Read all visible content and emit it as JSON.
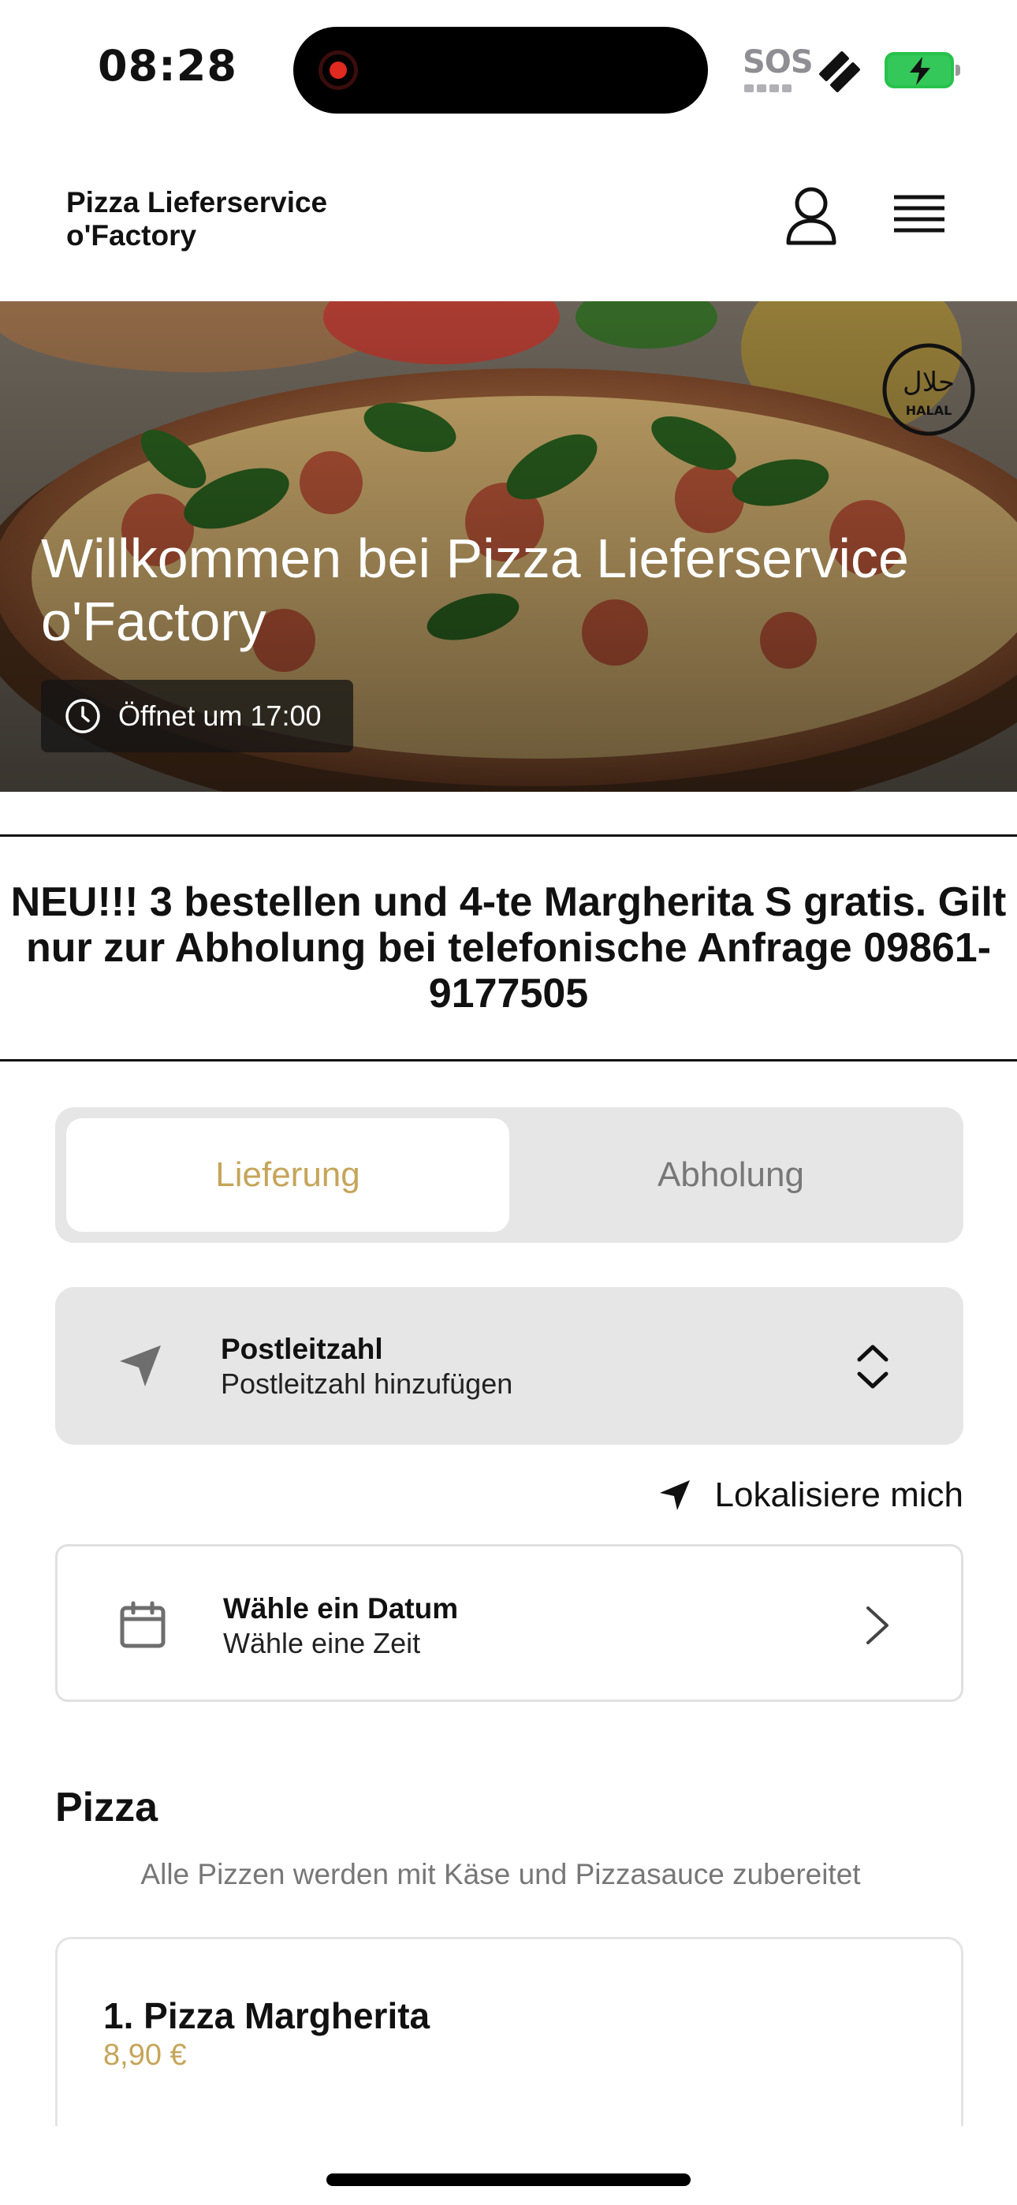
{
  "status_bar": {
    "time": "08:28",
    "sos": "SOS"
  },
  "header": {
    "brand_line1": "Pizza Lieferservice",
    "brand_line2": "o'Factory"
  },
  "hero": {
    "title": "Willkommen bei Pizza Lieferservice o'Factory",
    "opening": "Öffnet um 17:00",
    "halal_arabic": "حلال",
    "halal_label": "HALAL"
  },
  "announcement": {
    "text": "NEU!!! 3 bestellen und 4-te Margherita S gratis. Gilt nur zur Abholung bei telefonische Anfrage 09861-9177505"
  },
  "order_mode": {
    "options": [
      "Lieferung",
      "Abholung"
    ],
    "selected": "Lieferung",
    "accent_color": "#c5a55a"
  },
  "postal": {
    "title": "Postleitzahl",
    "placeholder": "Postleitzahl hinzufügen"
  },
  "locate": {
    "label": "Lokalisiere mich"
  },
  "date": {
    "title": "Wähle ein Datum",
    "subtitle": "Wähle eine Zeit"
  },
  "category": {
    "title": "Pizza",
    "description": "Alle Pizzen werden mit Käse und Pizzasauce zubereitet"
  },
  "items": [
    {
      "name": "1. Pizza Margherita",
      "price": "8,90 €"
    }
  ]
}
